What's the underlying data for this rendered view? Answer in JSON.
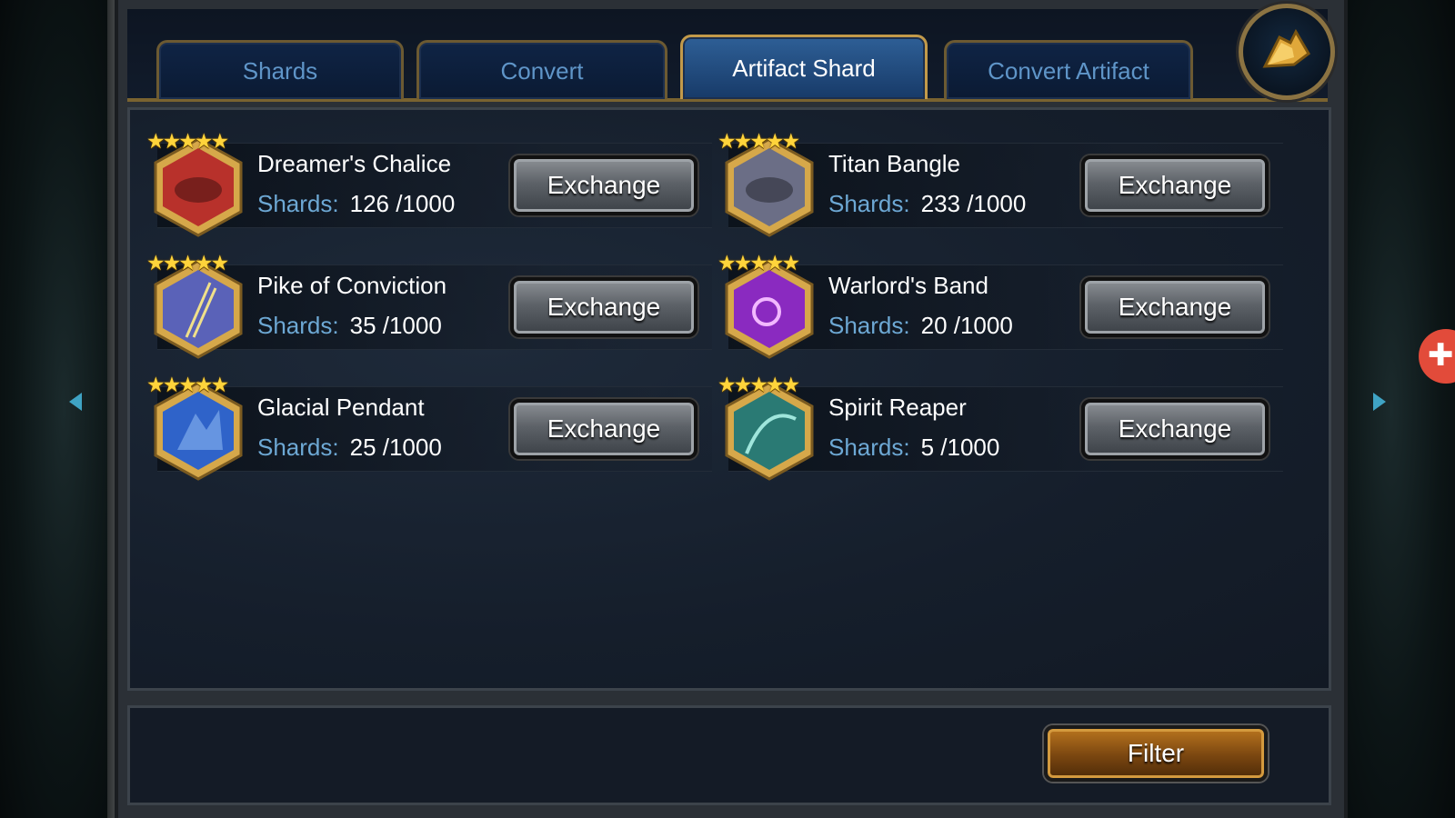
{
  "tabs": [
    {
      "label": "Shards",
      "active": false
    },
    {
      "label": "Convert",
      "active": false
    },
    {
      "label": "Artifact Shard",
      "active": true
    },
    {
      "label": "Convert Artifact",
      "active": false
    }
  ],
  "return_icon": "return-arrow-icon",
  "items": [
    {
      "name": "Dreamer's Chalice",
      "shards_label": "Shards:",
      "shards_value": "126 /1000",
      "stars": "★★★★★",
      "exchange_label": "Exchange",
      "art_color": "#b8312b"
    },
    {
      "name": "Titan Bangle",
      "shards_label": "Shards:",
      "shards_value": "233 /1000",
      "stars": "★★★★★",
      "exchange_label": "Exchange",
      "art_color": "#6b6e86"
    },
    {
      "name": "Pike of Conviction",
      "shards_label": "Shards:",
      "shards_value": "35 /1000",
      "stars": "★★★★★",
      "exchange_label": "Exchange",
      "art_color": "#5a62b8"
    },
    {
      "name": "Warlord's Band",
      "shards_label": "Shards:",
      "shards_value": "20 /1000",
      "stars": "★★★★★",
      "exchange_label": "Exchange",
      "art_color": "#8a2ac0"
    },
    {
      "name": "Glacial Pendant",
      "shards_label": "Shards:",
      "shards_value": "25 /1000",
      "stars": "★★★★★",
      "exchange_label": "Exchange",
      "art_color": "#2f63c9"
    },
    {
      "name": "Spirit Reaper",
      "shards_label": "Shards:",
      "shards_value": "5 /1000",
      "stars": "★★★★★",
      "exchange_label": "Exchange",
      "art_color": "#2a7a74"
    }
  ],
  "filter_label": "Filter",
  "floating_widget_symbol": "✚",
  "colors": {
    "accent_gold": "#c29a4a",
    "shards_label": "#6da8d4",
    "active_tab": "#2e5f96"
  }
}
